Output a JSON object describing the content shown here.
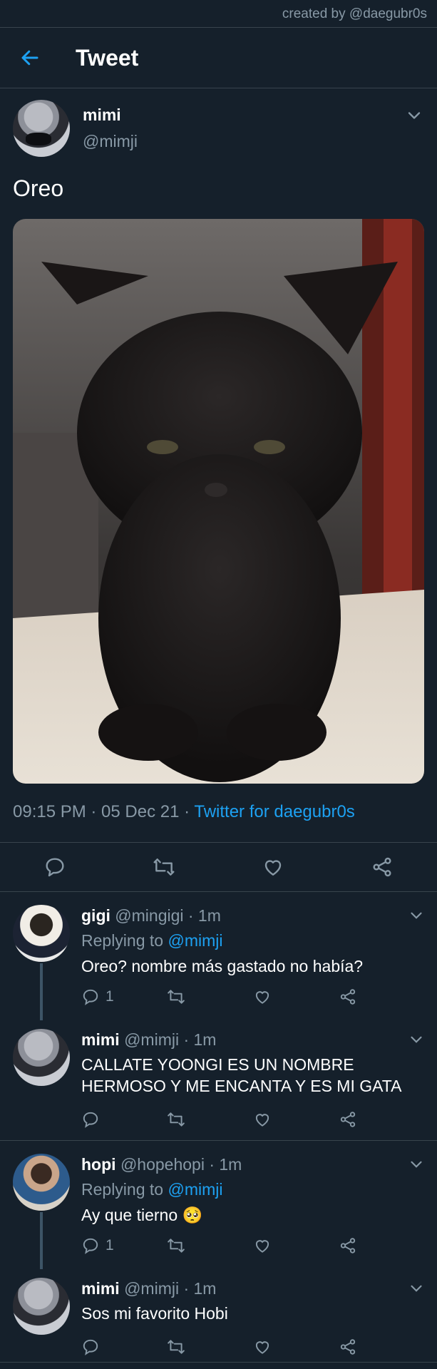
{
  "credit": "created by @daegubr0s",
  "header": {
    "title": "Tweet"
  },
  "tweet": {
    "author_name": "mimi",
    "author_handle": "@mimji",
    "text": "Oreo",
    "time": "09:15 PM · 05 Dec 21 · ",
    "source": "Twitter for daegubr0s"
  },
  "replies": [
    {
      "name": "gigi",
      "handle": "@mingigi · 1m",
      "replying_prefix": "Replying to ",
      "replying_to": "@mimji",
      "text": "Oreo? nombre más gastado no había?",
      "reply_count": "1"
    },
    {
      "name": "mimi",
      "handle": "@mimji · 1m",
      "text": "CALLATE YOONGI ES UN NOMBRE HERMOSO Y ME ENCANTA Y ES MI GATA",
      "reply_count": ""
    },
    {
      "name": "hopi",
      "handle": "@hopehopi · 1m",
      "replying_prefix": "Replying to ",
      "replying_to": "@mimji",
      "text": "Ay que tierno 🥺",
      "reply_count": "1"
    },
    {
      "name": "mimi",
      "handle": "@mimji · 1m",
      "text": "Sos mi favorito Hobi",
      "reply_count": ""
    }
  ],
  "icons": {
    "back": "arrow-left-icon",
    "caret": "chevron-down-icon",
    "reply": "comment-icon",
    "retweet": "retweet-icon",
    "like": "heart-icon",
    "share": "share-icon"
  },
  "colors": {
    "background": "#15202b",
    "accent": "#1da1f2",
    "muted": "#8899a6",
    "border": "#38444d"
  }
}
